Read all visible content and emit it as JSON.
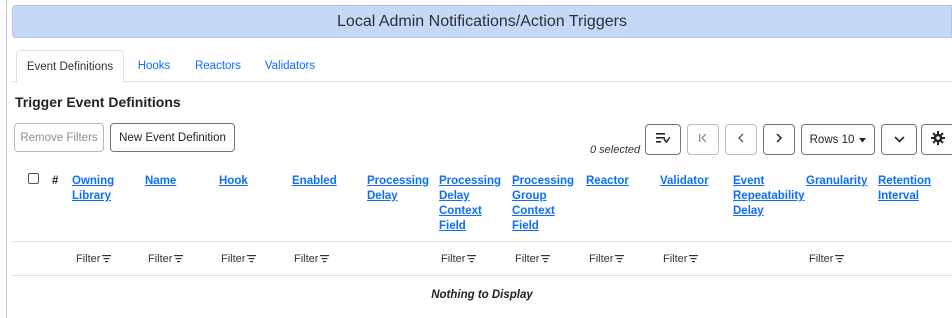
{
  "title": "Local Admin Notifications/Action Triggers",
  "tabs": [
    {
      "label": "Event Definitions",
      "active": true
    },
    {
      "label": "Hooks"
    },
    {
      "label": "Reactors"
    },
    {
      "label": "Validators"
    }
  ],
  "section_title": "Trigger Event Definitions",
  "toolbar": {
    "remove_filters": "Remove Filters",
    "new_event_definition": "New Event Definition",
    "selected_count": "0 selected",
    "rows_label": "Rows 10"
  },
  "table": {
    "select_all_col": "#",
    "columns": [
      "Owning Library",
      "Name",
      "Hook",
      "Enabled",
      "Processing Delay",
      "Processing Delay Context Field",
      "Processing Group Context Field",
      "Reactor",
      "Validator",
      "Event Repeatability Delay",
      "Granularity",
      "Retention Interval"
    ],
    "filter_label": "Filter",
    "empty_message": "Nothing to Display"
  },
  "icons": {
    "filter": "filter-icon",
    "column_picker": "column-picker-icon",
    "first_page": "first-page-icon",
    "prev_page": "prev-page-icon",
    "next_page": "next-page-icon",
    "expand": "chevron-down-icon",
    "settings": "gear-icon"
  },
  "colors": {
    "title_bar": "#c5d9f7",
    "link": "#0d6efd"
  }
}
